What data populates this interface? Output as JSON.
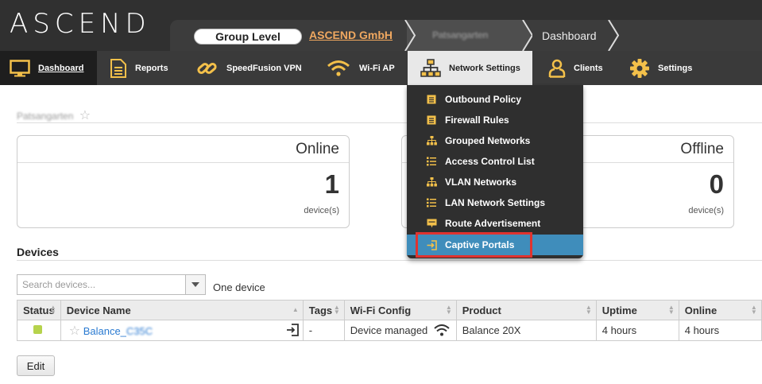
{
  "header": {
    "logo": "ASCEND",
    "breadcrumb": {
      "group_level": "Group Level",
      "organization": "ASCEND GmbH",
      "site": "Patsangarten",
      "current": "Dashboard"
    }
  },
  "nav": [
    {
      "label": "Dashboard",
      "icon": "monitor-icon"
    },
    {
      "label": "Reports",
      "icon": "document-icon"
    },
    {
      "label": "SpeedFusion VPN",
      "icon": "link-icon"
    },
    {
      "label": "Wi-Fi AP",
      "icon": "wifi-icon"
    },
    {
      "label": "Network Settings",
      "icon": "network-tree-icon"
    },
    {
      "label": "Clients",
      "icon": "person-icon"
    },
    {
      "label": "Settings",
      "icon": "gear-icon"
    }
  ],
  "dropdown": [
    {
      "label": "Outbound Policy",
      "icon": "list-doc-icon"
    },
    {
      "label": "Firewall Rules",
      "icon": "list-doc-icon"
    },
    {
      "label": "Grouped Networks",
      "icon": "network-tree-icon"
    },
    {
      "label": "Access Control List",
      "icon": "bullet-list-icon"
    },
    {
      "label": "VLAN Networks",
      "icon": "network-tree-icon"
    },
    {
      "label": "LAN Network Settings",
      "icon": "bullet-list-icon"
    },
    {
      "label": "Route Advertisement",
      "icon": "rds-icon"
    },
    {
      "label": "Captive Portals",
      "icon": "portal-icon"
    }
  ],
  "page": {
    "title": "Patsangarten",
    "cards": {
      "online": {
        "label": "Online",
        "count": "1",
        "unit": "device(s)"
      },
      "offline": {
        "label": "Offline",
        "count": "0",
        "unit": "device(s)"
      }
    },
    "devices_title": "Devices",
    "search_placeholder": "Search devices...",
    "device_count": "One device",
    "columns": [
      "Status",
      "Device Name",
      "Tags",
      "Wi-Fi Config",
      "Product",
      "Uptime",
      "Online"
    ],
    "rows": [
      {
        "name_prefix": "Balance_",
        "name_blurred": "C35C",
        "tags": "-",
        "wifi": "Device managed",
        "product": "Balance 20X",
        "uptime": "4 hours",
        "online": "4 hours"
      }
    ],
    "edit_label": "Edit"
  },
  "colors": {
    "accent": "#3f8dbb",
    "org_link": "#f0a860",
    "status_online": "#b6d34c",
    "highlight": "#e0332f"
  }
}
